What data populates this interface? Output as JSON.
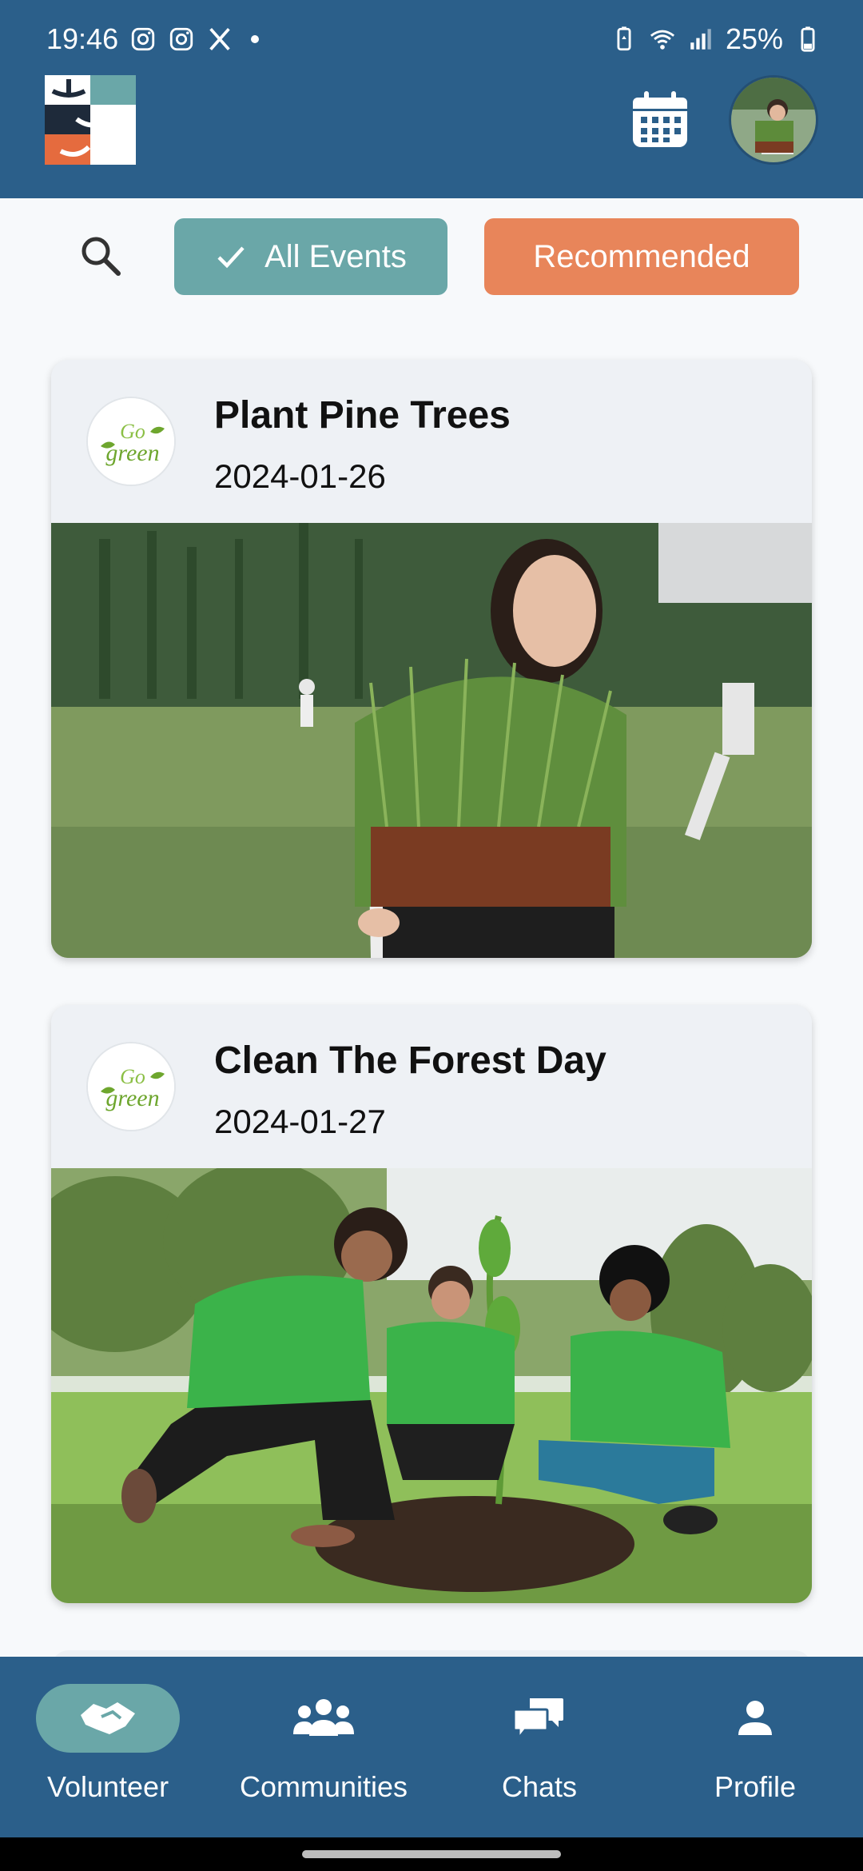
{
  "status_bar": {
    "time": "19:46",
    "battery": "25%",
    "icons": [
      "instagram-icon",
      "instagram-icon",
      "x-icon",
      "notification-dot",
      "battery-saver-icon",
      "wifi-icon",
      "signal-icon",
      "battery-icon"
    ]
  },
  "header": {
    "logo_icon": "app-logo",
    "calendar_icon": "calendar-icon",
    "avatar_icon": "profile-avatar"
  },
  "filters": {
    "search_icon": "search-icon",
    "all_events_label": "All Events",
    "recommended_label": "Recommended",
    "active": "All Events"
  },
  "events": [
    {
      "title": "Plant Pine Trees",
      "date": "2024-01-26",
      "org_logo_text": "Go green"
    },
    {
      "title": "Clean The Forest Day",
      "date": "2024-01-27",
      "org_logo_text": "Go green"
    }
  ],
  "bottom_nav": {
    "items": [
      {
        "label": "Volunteer",
        "icon": "handshake-icon",
        "active": true
      },
      {
        "label": "Communities",
        "icon": "people-group-icon",
        "active": false
      },
      {
        "label": "Chats",
        "icon": "chat-bubbles-icon",
        "active": false
      },
      {
        "label": "Profile",
        "icon": "person-icon",
        "active": false
      }
    ]
  },
  "colors": {
    "header_bg": "#2B5F8A",
    "chip_all": "#6AA7A8",
    "chip_recommended": "#E8855A",
    "card_bg": "#EEF1F5"
  }
}
